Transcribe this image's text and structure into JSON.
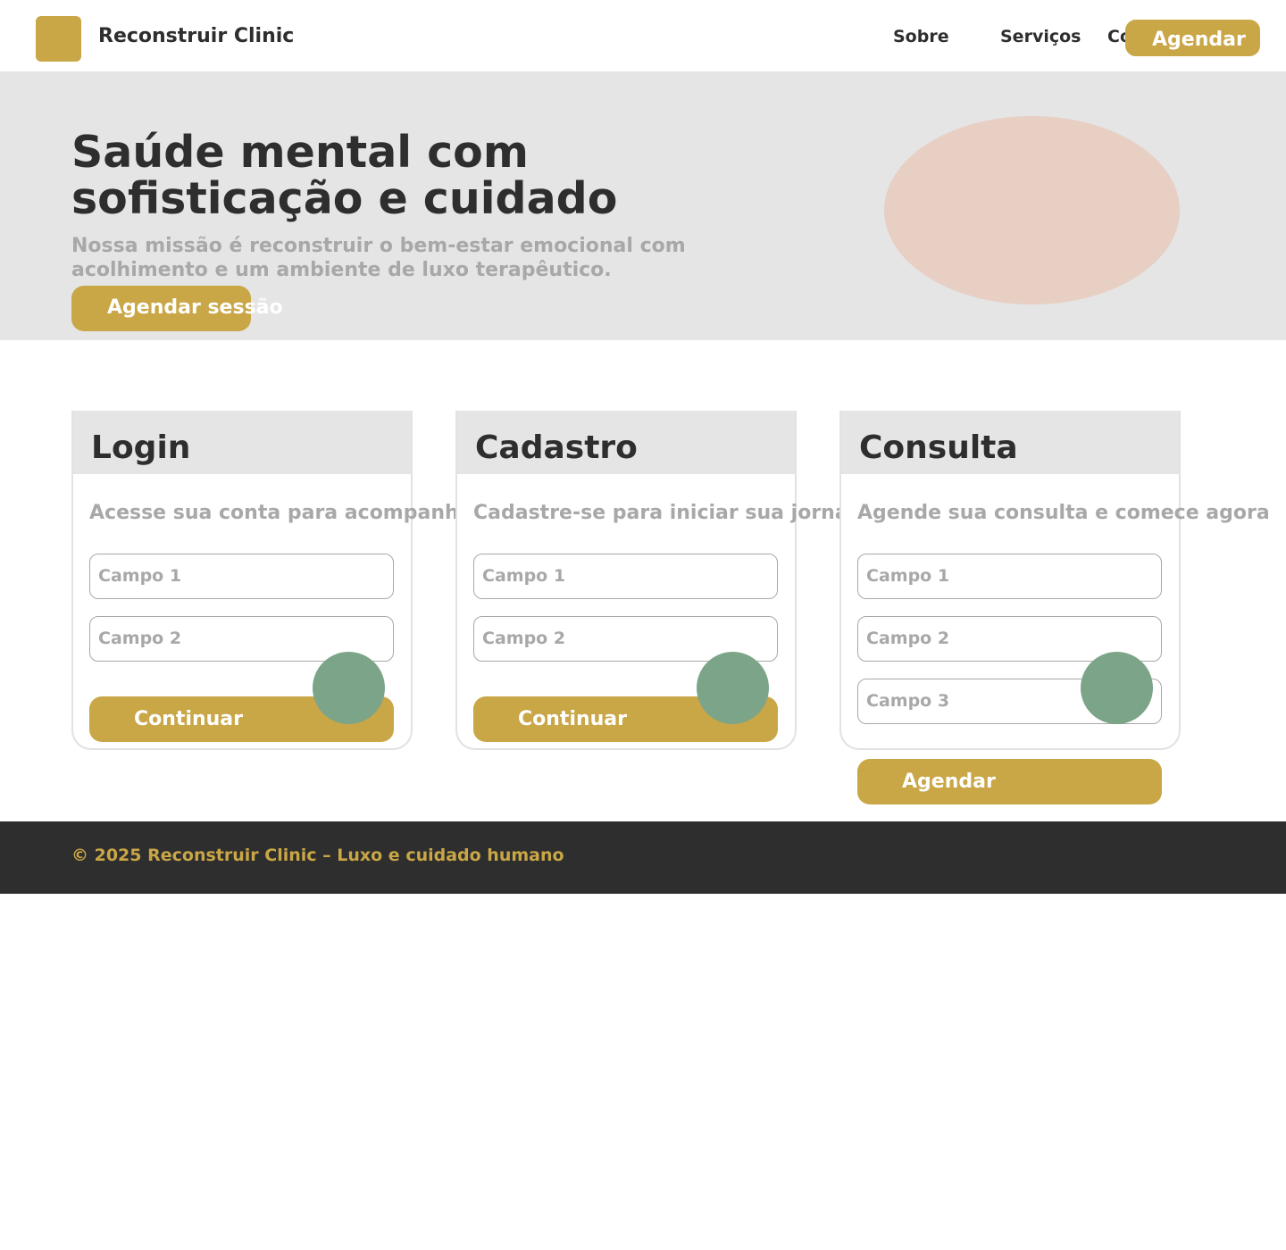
{
  "header": {
    "brand": "Reconstruir Clinic",
    "nav": [
      "Sobre",
      "Serviços",
      "Contato"
    ],
    "cta": "Agendar"
  },
  "hero": {
    "title": "Saúde mental com sofisticação e cuidado",
    "subtitle": "Nossa missão é reconstruir o bem-estar emocional com acolhimento e um ambiente de luxo terapêutico.",
    "cta": "Agendar sessão"
  },
  "cards": [
    {
      "title": "Login",
      "description": "Acesse sua conta para acompanhar suas sessões",
      "fields": [
        "Campo 1",
        "Campo 2"
      ],
      "button": "Continuar"
    },
    {
      "title": "Cadastro",
      "description": "Cadastre-se para iniciar sua jornada",
      "fields": [
        "Campo 1",
        "Campo 2"
      ],
      "button": "Continuar"
    },
    {
      "title": "Consulta",
      "description": "Agende sua consulta e comece agora",
      "fields": [
        "Campo 1",
        "Campo 2",
        "Campo 3"
      ],
      "button": "Agendar"
    }
  ],
  "footer": {
    "text": "© 2025 Reconstruir Clinic – Luxo e cuidado humano"
  },
  "colors": {
    "gold": "#c9a646",
    "dark": "#2e2e2e",
    "muted": "#a8a8a8",
    "panel": "#e5e5e5",
    "blush": "#e8cfc4",
    "sage": "#7ca489"
  }
}
